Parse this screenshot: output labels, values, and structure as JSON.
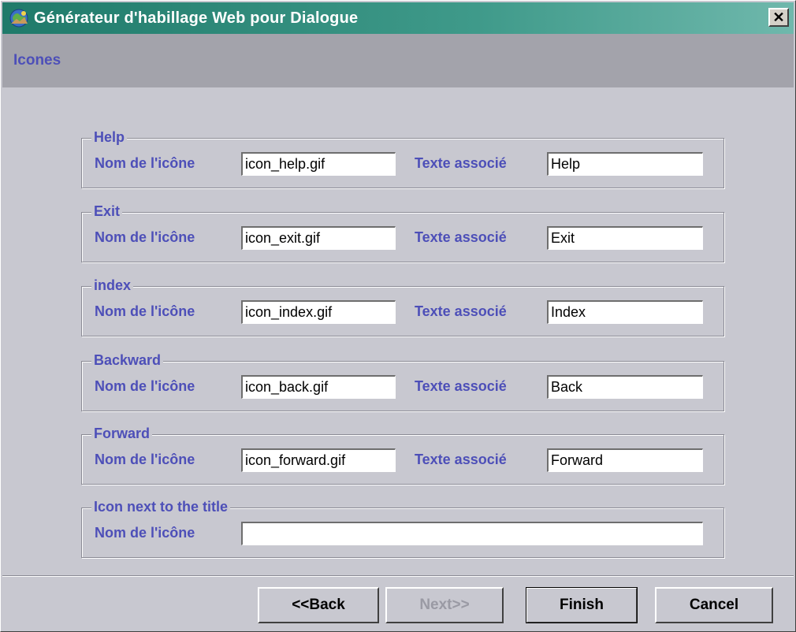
{
  "window": {
    "title": "Générateur d'habillage Web pour Dialogue",
    "close_glyph": "✕"
  },
  "section": {
    "title": "Icones"
  },
  "groups": [
    {
      "legend": "Help",
      "icon_label": "Nom de l'icône",
      "icon_value": "icon_help.gif",
      "text_label": "Texte associé",
      "text_value": "Help"
    },
    {
      "legend": "Exit",
      "icon_label": "Nom de l'icône",
      "icon_value": "icon_exit.gif",
      "text_label": "Texte associé",
      "text_value": "Exit"
    },
    {
      "legend": "index",
      "icon_label": "Nom de l'icône",
      "icon_value": "icon_index.gif",
      "text_label": "Texte associé",
      "text_value": "Index"
    },
    {
      "legend": "Backward",
      "icon_label": "Nom de l'icône",
      "icon_value": "icon_back.gif",
      "text_label": "Texte associé",
      "text_value": "Back"
    },
    {
      "legend": "Forward",
      "icon_label": "Nom de l'icône",
      "icon_value": "icon_forward.gif",
      "text_label": "Texte associé",
      "text_value": "Forward"
    },
    {
      "legend": "Icon next to the title",
      "icon_label": "Nom de l'icône",
      "icon_value": ""
    }
  ],
  "buttons": {
    "back": "<<Back",
    "next": "Next>>",
    "finish": "Finish",
    "cancel": "Cancel"
  },
  "colors": {
    "label": "#4d4fb8",
    "titlebar": "#1f7a6a",
    "background": "#c8c8d0"
  }
}
